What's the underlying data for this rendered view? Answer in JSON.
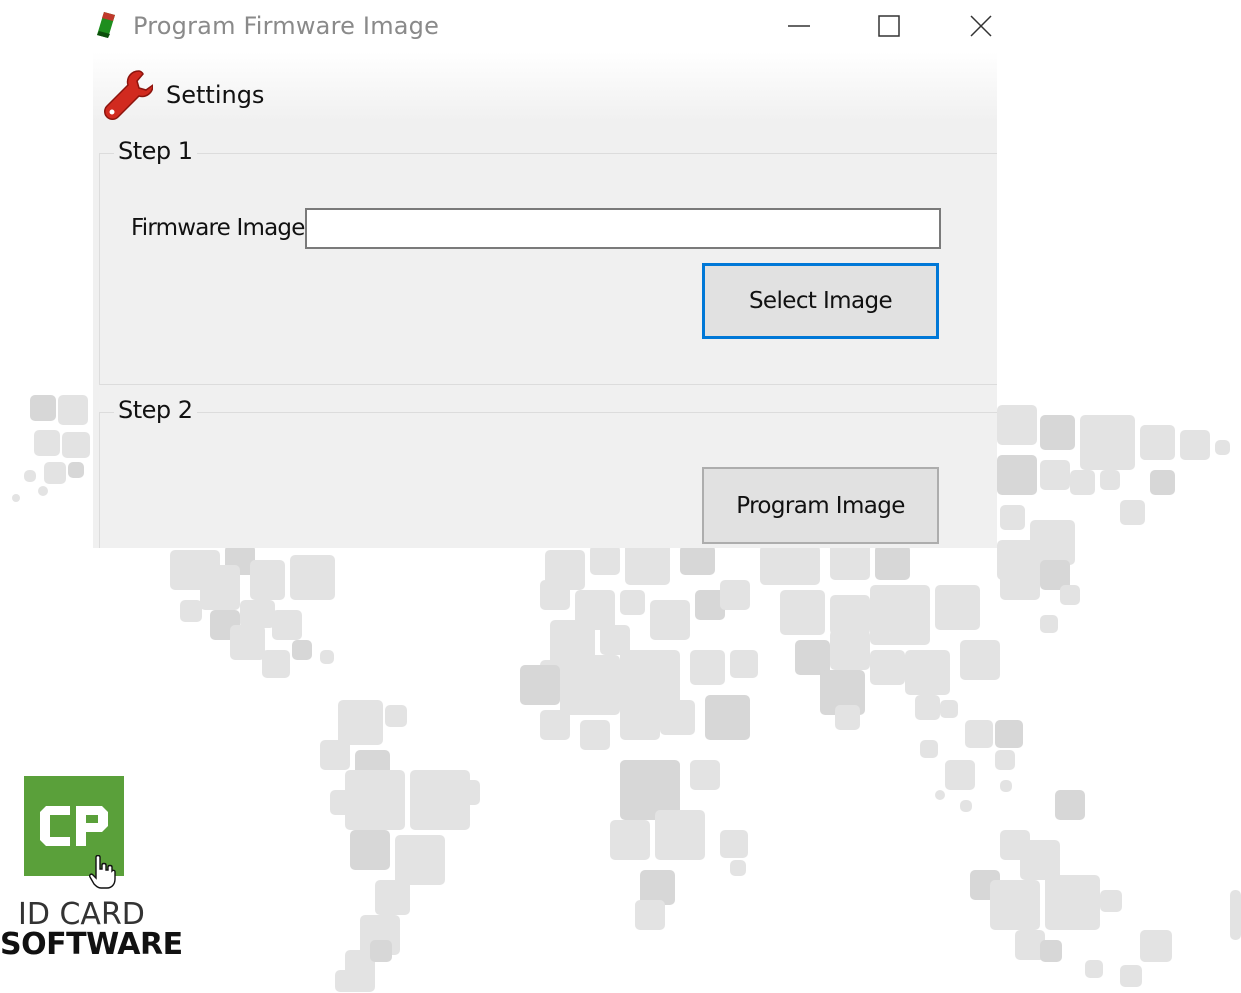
{
  "window": {
    "title": "Program Firmware Image",
    "controls": {
      "minimize_icon": "minimize-icon",
      "maximize_icon": "maximize-icon",
      "close_icon": "close-icon"
    }
  },
  "menu": {
    "settings_label": "Settings",
    "settings_icon": "wrench-icon"
  },
  "step1": {
    "group_label": "Step 1",
    "firmware_label": "Firmware Image:",
    "firmware_value": "",
    "select_button": "Select Image"
  },
  "step2": {
    "group_label": "Step 2",
    "program_button": "Program Image"
  },
  "background": {
    "logo_line1": "ID CARD",
    "logo_line2": "SOFTWARE",
    "logo_mark_color": "#5aa03a",
    "accent_color": "#0078d7"
  }
}
